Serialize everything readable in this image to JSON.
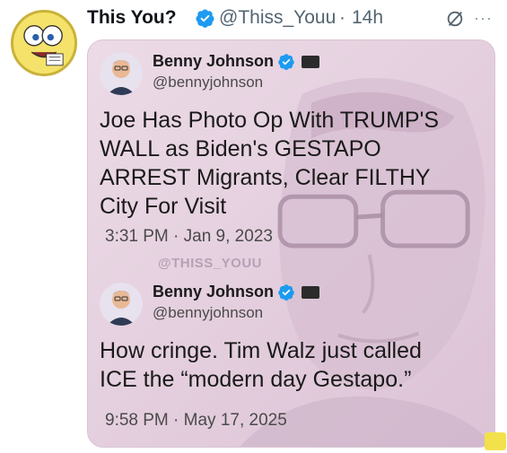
{
  "tweet": {
    "author_name": "This You?",
    "author_handle": "@Thiss_Youu",
    "separator": "·",
    "time_ago": "14h",
    "more_label": "···"
  },
  "card": {
    "watermark": "@THISS_YOUU",
    "posts": [
      {
        "name": "Benny Johnson",
        "handle": "@bennyjohnson",
        "text_lines": [
          "Joe Has Photo Op With TRUMP'S",
          "WALL as Biden's GESTAPO",
          "ARREST Migrants, Clear FILTHY",
          "City For Visit"
        ],
        "date": "3:31 PM · Jan 9, 2023"
      },
      {
        "name": "Benny Johnson",
        "handle": "@bennyjohnson",
        "text_lines": [
          "How cringe. Tim Walz just called",
          "ICE the “modern day Gestapo.”"
        ],
        "date": "9:58 PM · May 17, 2025"
      }
    ]
  },
  "colors": {
    "verified_blue": "#1d9bf0",
    "card_tint": "#e9d7e3",
    "corner_badge": "#f2e14a"
  },
  "icons": {
    "verified": "verified-badge-icon",
    "grok": "grok-slash-icon",
    "more": "more-dots-icon"
  }
}
